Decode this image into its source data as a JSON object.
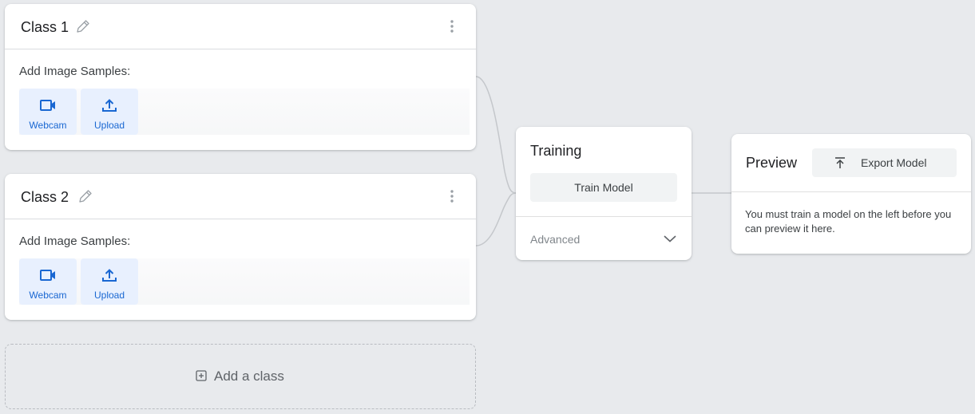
{
  "classes": [
    {
      "title": "Class 1",
      "samples_label": "Add Image Samples:",
      "webcam_label": "Webcam",
      "upload_label": "Upload"
    },
    {
      "title": "Class 2",
      "samples_label": "Add Image Samples:",
      "webcam_label": "Webcam",
      "upload_label": "Upload"
    }
  ],
  "add_class": {
    "label": "Add a class"
  },
  "training": {
    "title": "Training",
    "train_button_label": "Train Model",
    "advanced_label": "Advanced"
  },
  "preview": {
    "title": "Preview",
    "export_button_label": "Export Model",
    "message": "You must train a model on the left before you can preview it here."
  },
  "icons": {
    "edit": "pencil-icon",
    "menu": "more-vert-icon",
    "webcam": "videocam-icon",
    "upload": "upload-icon",
    "add": "add-box-icon",
    "expand": "chevron-down-icon",
    "export": "export-icon"
  },
  "colors": {
    "background": "#e8eaed",
    "card": "#ffffff",
    "accent": "#1967d2",
    "accent_light": "#e8f0fe",
    "button_gray": "#f1f3f4"
  }
}
